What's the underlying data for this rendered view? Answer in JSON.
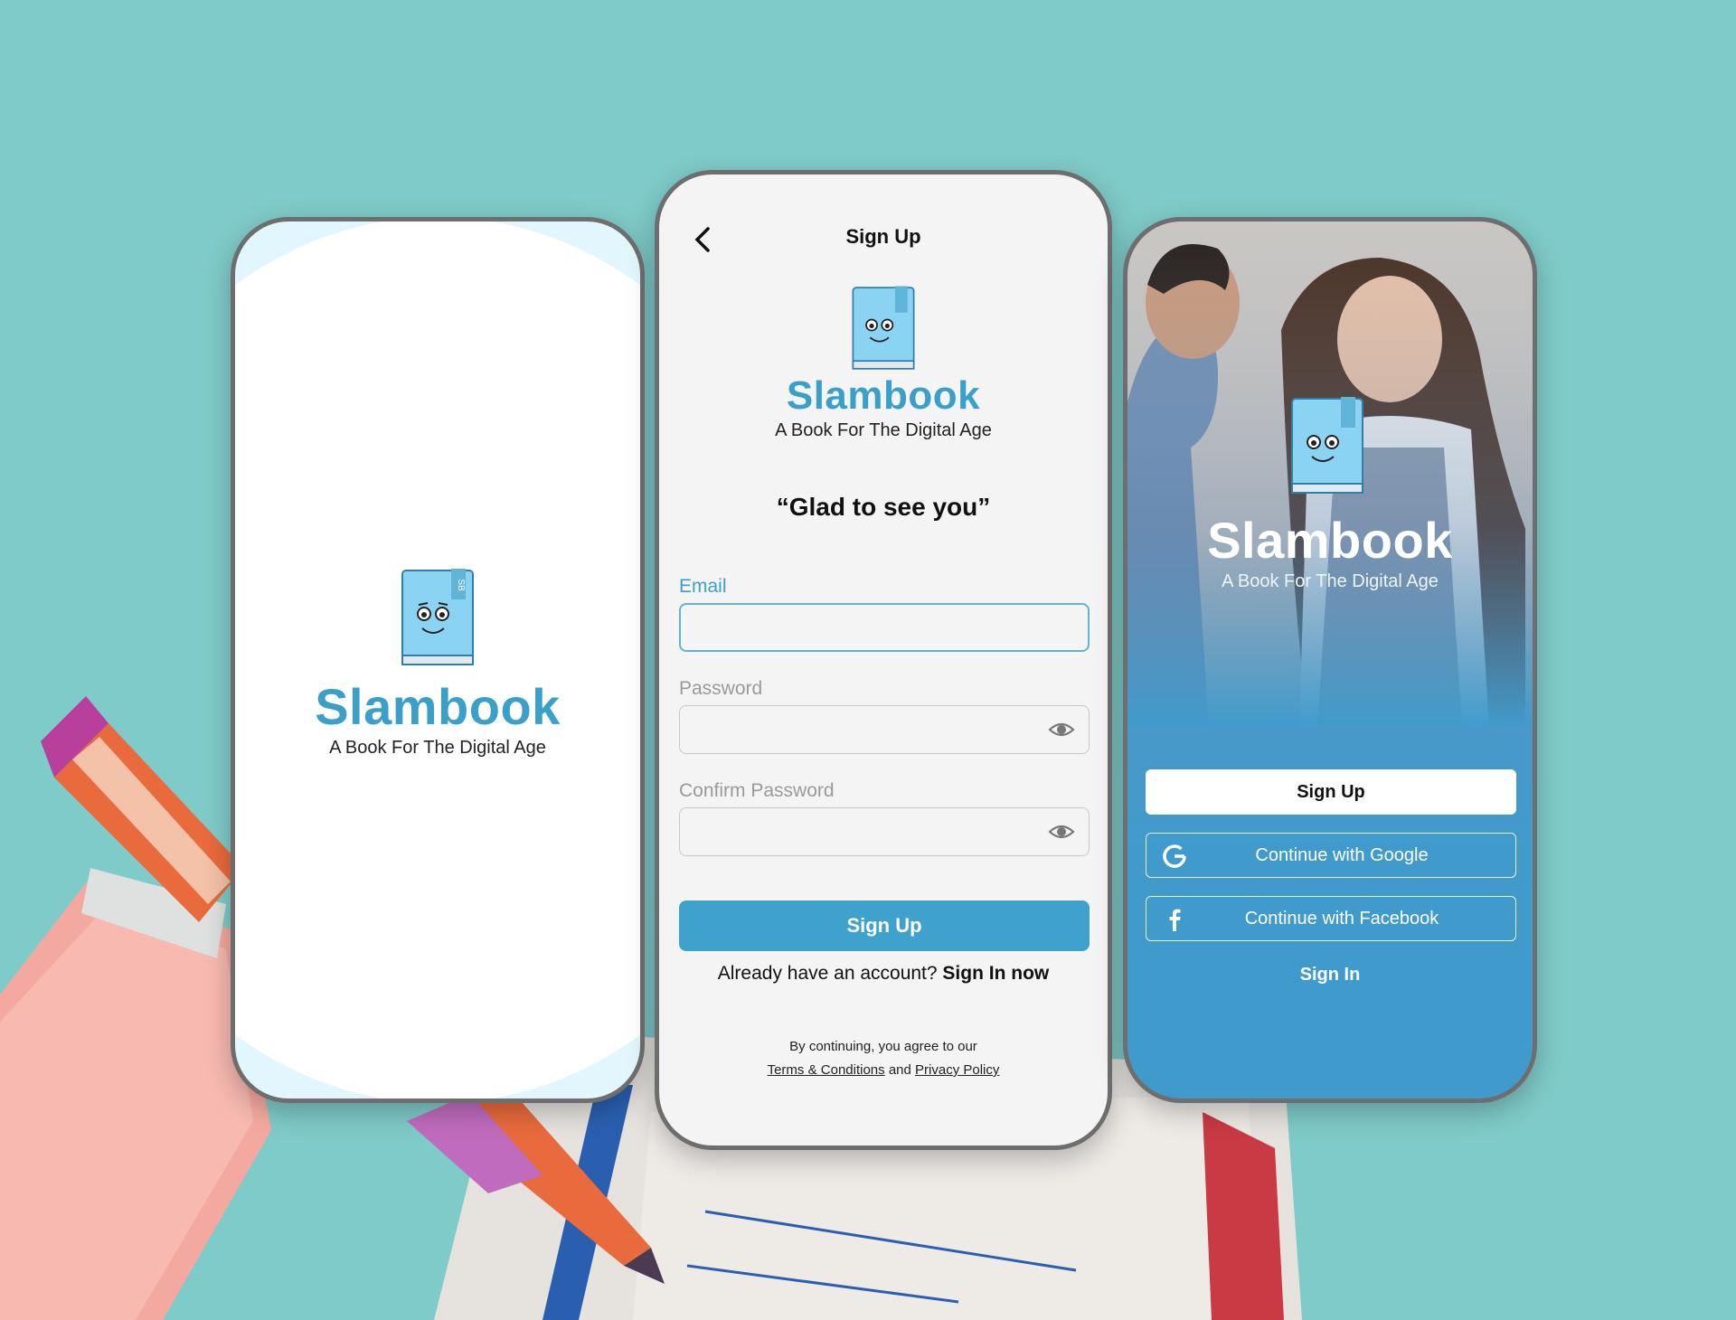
{
  "brand": {
    "name": "Slambook",
    "tagline": "A Book For The Digital Age",
    "logo_badge": "SB",
    "colors": {
      "primary": "#3ea2cc",
      "title": "#3aa0c8",
      "background": "#7fcbc9"
    }
  },
  "splash": {
    "title": "Slambook",
    "tagline": "A Book For The Digital Age"
  },
  "signup": {
    "header_title": "Sign Up",
    "back_icon": "chevron-left-icon",
    "title": "Slambook",
    "tagline": "A Book For The Digital Age",
    "greeting": "“Glad to see you”",
    "email": {
      "label": "Email",
      "value": "",
      "placeholder": ""
    },
    "password": {
      "label": "Password",
      "value": "",
      "placeholder": "",
      "icon": "eye-icon"
    },
    "confirm_password": {
      "label": "Confirm Password",
      "value": "",
      "placeholder": "",
      "icon": "eye-icon"
    },
    "submit_label": "Sign Up",
    "already_text": "Already have an account?",
    "signin_link": "Sign In now",
    "legal_prefix": "By continuing, you agree to our",
    "terms_link": "Terms & Conditions",
    "legal_and": "and",
    "privacy_link": "Privacy Policy"
  },
  "welcome": {
    "title": "Slambook",
    "tagline": "A Book For The Digital Age",
    "signup_label": "Sign Up",
    "google_label": "Continue with Google",
    "google_icon": "google-icon",
    "facebook_label": "Continue with Facebook",
    "facebook_icon": "facebook-icon",
    "signin_label": "Sign In"
  }
}
